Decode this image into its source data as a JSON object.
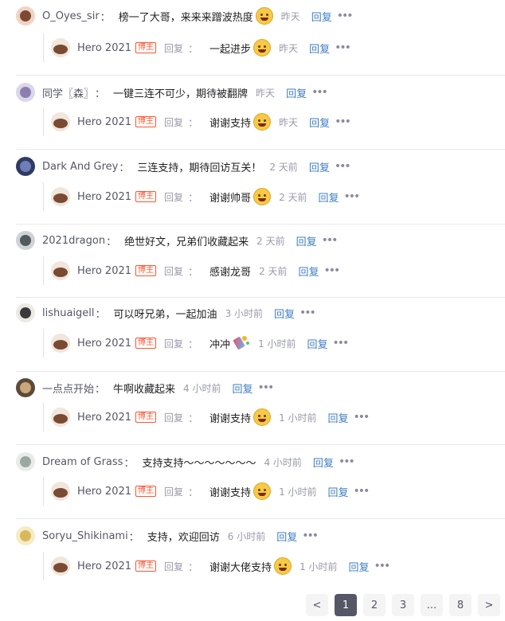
{
  "comments": [
    {
      "user": "O_Oyes_sir",
      "text": "榜一了大哥，来来来蹭波热度",
      "emoji": "pleading-face",
      "time": "昨天",
      "reply_label": "回复",
      "avatar_colors": [
        "#f1d3c4",
        "#7a4a33"
      ],
      "reply": {
        "user": "Hero 2021",
        "badge": "博主",
        "reply_word": "回复",
        "text": "一起进步",
        "emoji": "grin-face",
        "time": "昨天",
        "reply_label": "回复"
      }
    },
    {
      "user": "同学〖森〗",
      "text": "一键三连不可少，期待被翻牌",
      "emoji": "",
      "time": "昨天",
      "reply_label": "回复",
      "avatar_colors": [
        "#dcd6ea",
        "#8c7fb0"
      ],
      "reply": {
        "user": "Hero 2021",
        "badge": "博主",
        "reply_word": "回复",
        "text": "谢谢支持",
        "emoji": "grin-face",
        "time": "昨天",
        "reply_label": "回复"
      }
    },
    {
      "user": "Dark And Grey",
      "text": "三连支持，期待回访互关！",
      "emoji": "",
      "time": "2 天前",
      "reply_label": "回复",
      "avatar_colors": [
        "#2f3b63",
        "#6d7fb5"
      ],
      "reply": {
        "user": "Hero 2021",
        "badge": "博主",
        "reply_word": "回复",
        "text": "谢谢帅哥",
        "emoji": "grin-face",
        "time": "2 天前",
        "reply_label": "回复"
      }
    },
    {
      "user": "2021dragon",
      "text": "绝世好文，兄弟们收藏起来",
      "emoji": "",
      "time": "2 天前",
      "reply_label": "回复",
      "avatar_colors": [
        "#cfd3d6",
        "#505a5f"
      ],
      "reply": {
        "user": "Hero 2021",
        "badge": "博主",
        "reply_word": "回复",
        "text": "感谢龙哥",
        "emoji": "",
        "time": "2 天前",
        "reply_label": "回复"
      }
    },
    {
      "user": "lishuaigell",
      "text": "可以呀兄弟，一起加油",
      "emoji": "",
      "time": "3 小时前",
      "reply_label": "回复",
      "avatar_colors": [
        "#ece9e4",
        "#3a3a3a"
      ],
      "reply": {
        "user": "Hero 2021",
        "badge": "博主",
        "reply_word": "回复",
        "text": "冲冲",
        "emoji": "party-popper",
        "time": "1 小时前",
        "reply_label": "回复"
      }
    },
    {
      "user": "一点点开始",
      "text": "牛啊收藏起来",
      "emoji": "",
      "time": "4 小时前",
      "reply_label": "回复",
      "avatar_colors": [
        "#5b4a3a",
        "#c9a77a"
      ],
      "reply": {
        "user": "Hero 2021",
        "badge": "博主",
        "reply_word": "回复",
        "text": "谢谢支持",
        "emoji": "smirk-face",
        "time": "1 小时前",
        "reply_label": "回复"
      }
    },
    {
      "user": "Dream of Grass",
      "text": "支持支持～～～～～～～",
      "emoji": "",
      "time": "4 小时前",
      "reply_label": "回复",
      "avatar_colors": [
        "#e7ece9",
        "#9aa9a0"
      ],
      "reply": {
        "user": "Hero 2021",
        "badge": "博主",
        "reply_word": "回复",
        "text": "谢谢支持",
        "emoji": "grin-face",
        "time": "1 小时前",
        "reply_label": "回复"
      }
    },
    {
      "user": "Soryu_Shikinami",
      "text": "支持，欢迎回访",
      "emoji": "",
      "time": "6 小时前",
      "reply_label": "回复",
      "avatar_colors": [
        "#f4ecc6",
        "#d9b85a"
      ],
      "reply": {
        "user": "Hero 2021",
        "badge": "博主",
        "reply_word": "回复",
        "text": "谢谢大佬支持",
        "emoji": "grin-face",
        "time": "1 小时前",
        "reply_label": "回复"
      }
    }
  ],
  "pagination": {
    "prev": "<",
    "pages": [
      "1",
      "2",
      "3",
      "...",
      "8"
    ],
    "active_page": "1",
    "next": ">"
  },
  "colors": {
    "link": "#3e7ec4",
    "badge": "#fc5531",
    "muted": "#999aaa",
    "active_page_bg": "#555666"
  }
}
